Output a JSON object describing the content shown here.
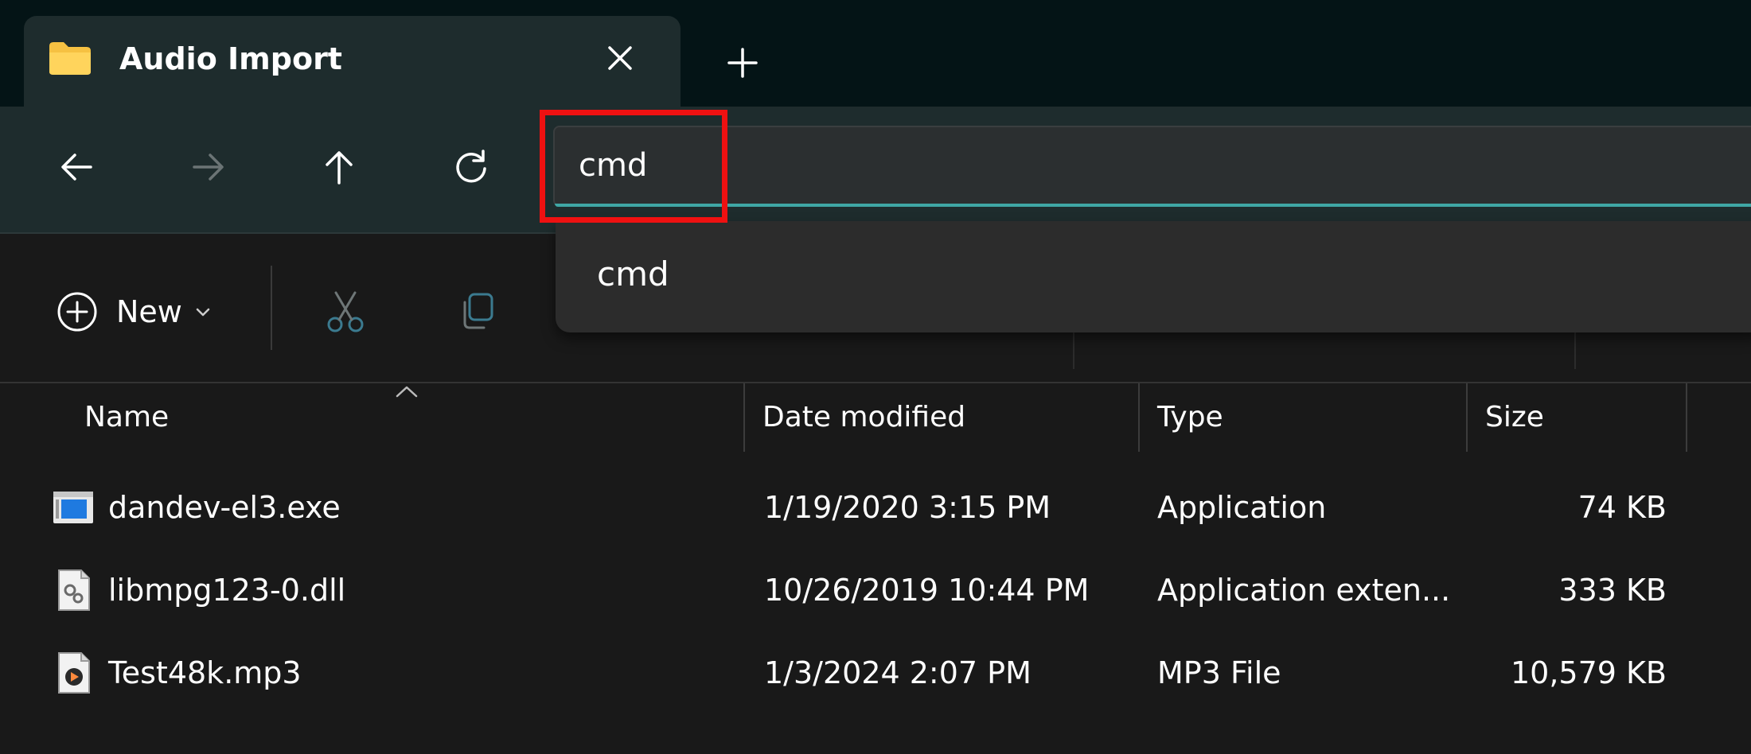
{
  "tab": {
    "title": "Audio Import",
    "icon": "folder-icon"
  },
  "nav": {
    "back": "back-arrow-icon",
    "forward": "forward-arrow-icon",
    "up": "up-arrow-icon",
    "refresh": "refresh-icon"
  },
  "address": {
    "value": "cmd"
  },
  "autocomplete": {
    "suggestion": "cmd"
  },
  "commandbar": {
    "new_label": "New"
  },
  "columns": {
    "name": "Name",
    "date": "Date modified",
    "type": "Type",
    "size": "Size"
  },
  "files": [
    {
      "name": "dandev-el3.exe",
      "date": "1/19/2020 3:15 PM",
      "type": "Application",
      "size": "74 KB",
      "icon": "exe-icon"
    },
    {
      "name": "libmpg123-0.dll",
      "date": "10/26/2019 10:44 PM",
      "type": "Application exten...",
      "size": "333 KB",
      "icon": "dll-icon"
    },
    {
      "name": "Test48k.mp3",
      "date": "1/3/2024 2:07 PM",
      "type": "MP3 File",
      "size": "10,579 KB",
      "icon": "mp3-icon"
    }
  ],
  "colors": {
    "accent": "#3fa7a5",
    "highlight": "#ee1111",
    "folder": "#f6c142"
  }
}
